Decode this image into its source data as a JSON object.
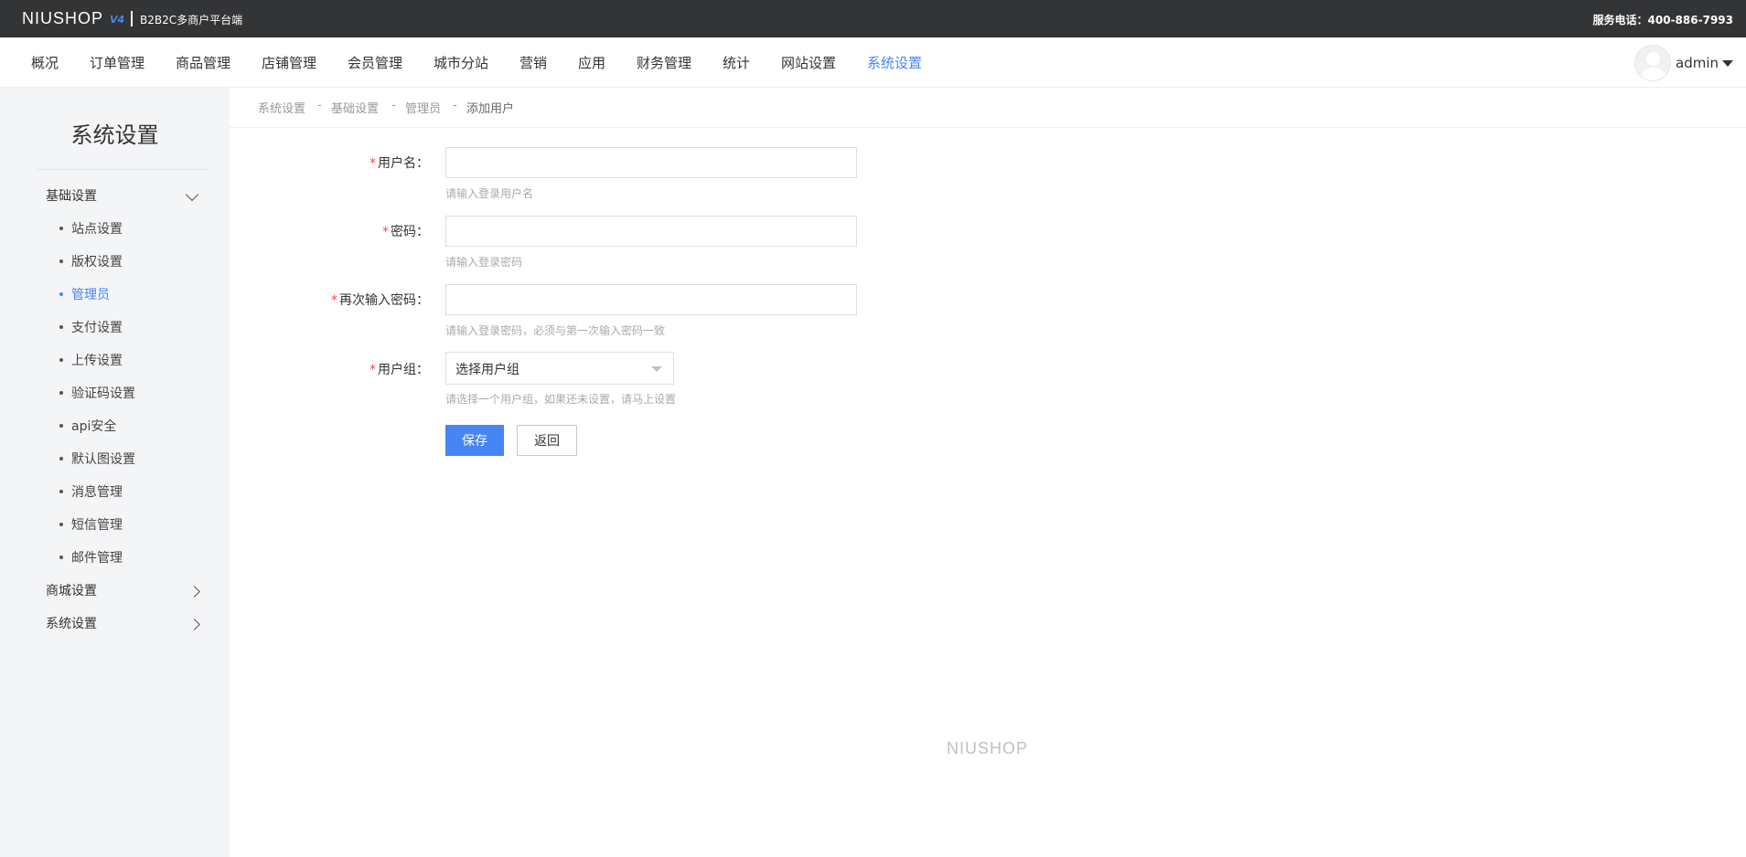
{
  "topbar": {
    "logo": "NIUSHOP",
    "logo_version": "V4",
    "subtitle": "B2B2C多商户平台端",
    "phone": "服务电话：400-886-7993"
  },
  "nav": {
    "items": [
      "概况",
      "订单管理",
      "商品管理",
      "店铺管理",
      "会员管理",
      "城市分站",
      "营销",
      "应用",
      "财务管理",
      "统计",
      "网站设置",
      "系统设置"
    ],
    "active": "系统设置",
    "user": "admin"
  },
  "sidebar": {
    "title": "系统设置",
    "groups": [
      {
        "label": "基础设置",
        "expanded": true,
        "items": [
          "站点设置",
          "版权设置",
          "管理员",
          "支付设置",
          "上传设置",
          "验证码设置",
          "api安全",
          "默认图设置",
          "消息管理",
          "短信管理",
          "邮件管理"
        ],
        "active": "管理员"
      },
      {
        "label": "商城设置",
        "expanded": false
      },
      {
        "label": "系统设置",
        "expanded": false
      }
    ]
  },
  "breadcrumb": [
    "系统设置",
    "基础设置",
    "管理员",
    "添加用户"
  ],
  "breadcrumb_sep": "-",
  "form": {
    "username": {
      "label": "用户名：",
      "value": "",
      "hint": "请输入登录用户名"
    },
    "password": {
      "label": "密码：",
      "value": "",
      "hint": "请输入登录密码"
    },
    "password_confirm": {
      "label": "再次输入密码：",
      "value": "",
      "hint": "请输入登录密码，必须与第一次输入密码一致"
    },
    "group": {
      "label": "用户组：",
      "value": "选择用户组",
      "hint": "请选择一个用户组，如果还未设置，请马上设置"
    },
    "required_mark": "*",
    "save": "保存",
    "back": "返回"
  },
  "footer": {
    "logo": "NIUSHOP"
  },
  "colors": {
    "accent": "#4685f4",
    "topbar": "#333436",
    "sidebar_bg": "#f4f5f7",
    "required": "#ff4444"
  }
}
